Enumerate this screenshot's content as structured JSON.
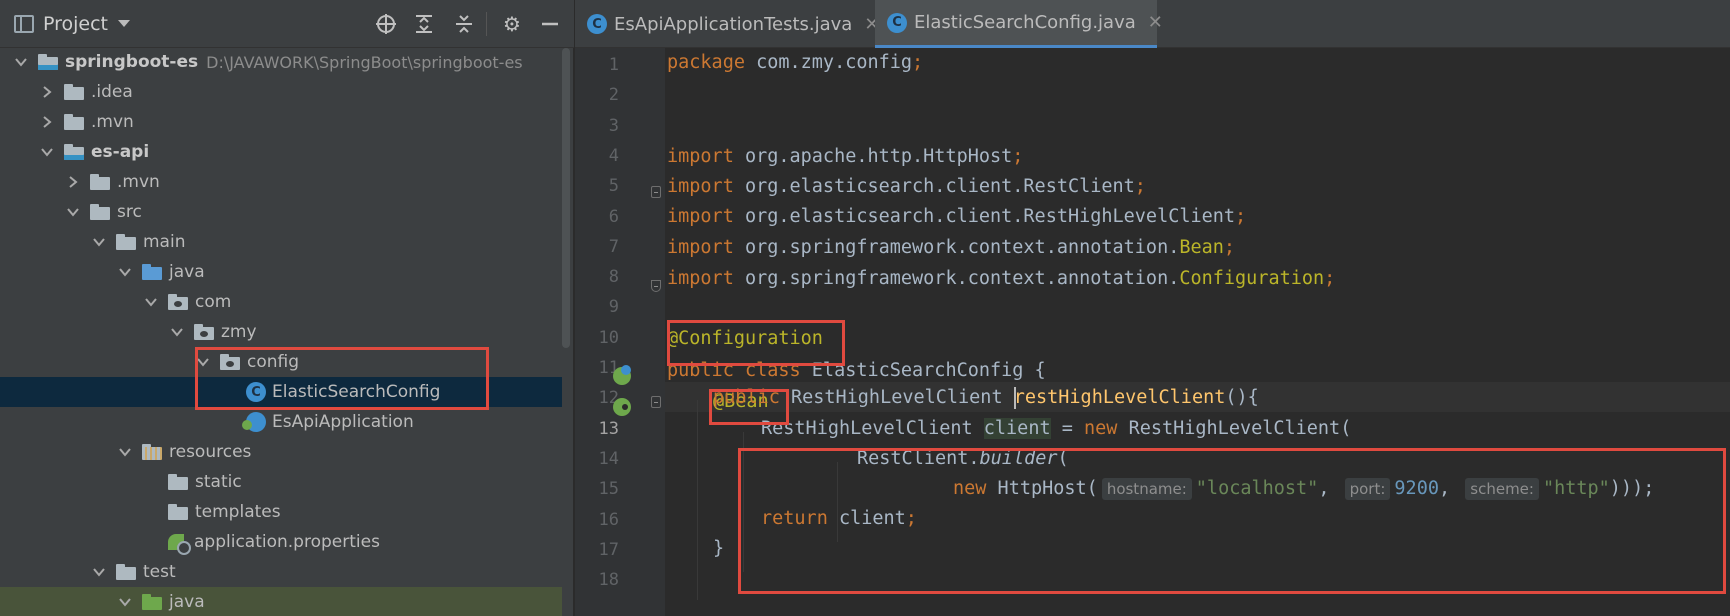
{
  "project_panel": {
    "title": "Project",
    "header_icons": [
      "locate-icon",
      "expand-all-icon",
      "collapse-all-icon",
      "gear-icon",
      "hide-icon"
    ],
    "tree": [
      {
        "label": "springboot-es",
        "path": "D:\\JAVAWORK\\SpringBoot\\springboot-es",
        "bold": true,
        "icon": "module-folder-icon",
        "expanded": true
      },
      {
        "label": ".idea",
        "icon": "folder-icon",
        "expanded": false
      },
      {
        "label": ".mvn",
        "icon": "folder-icon",
        "expanded": false
      },
      {
        "label": "es-api",
        "bold": true,
        "icon": "module-folder-icon",
        "expanded": true
      },
      {
        "label": ".mvn",
        "icon": "folder-icon",
        "expanded": false
      },
      {
        "label": "src",
        "icon": "folder-icon",
        "expanded": true
      },
      {
        "label": "main",
        "icon": "folder-icon",
        "expanded": true
      },
      {
        "label": "java",
        "icon": "source-folder-icon",
        "expanded": true
      },
      {
        "label": "com",
        "icon": "package-icon",
        "expanded": true
      },
      {
        "label": "zmy",
        "icon": "package-icon",
        "expanded": true
      },
      {
        "label": "config",
        "icon": "package-icon",
        "expanded": true
      },
      {
        "label": "ElasticSearchConfig",
        "icon": "class-icon",
        "selected": true
      },
      {
        "label": "EsApiApplication",
        "icon": "spring-boot-class-icon"
      },
      {
        "label": "resources",
        "icon": "resources-folder-icon",
        "expanded": true
      },
      {
        "label": "static",
        "icon": "folder-icon"
      },
      {
        "label": "templates",
        "icon": "folder-icon"
      },
      {
        "label": "application.properties",
        "icon": "spring-properties-icon"
      },
      {
        "label": "test",
        "icon": "folder-icon",
        "expanded": true
      },
      {
        "label": "java",
        "icon": "test-source-folder-icon",
        "expanded": true
      }
    ]
  },
  "tabs": [
    {
      "label": "EsApiApplicationTests.java",
      "active": false,
      "icon": "test-class-icon"
    },
    {
      "label": "ElasticSearchConfig.java",
      "active": true,
      "icon": "class-icon"
    }
  ],
  "editor": {
    "line_numbers": [
      "1",
      "2",
      "3",
      "4",
      "5",
      "6",
      "7",
      "8",
      "9",
      "10",
      "11",
      "12",
      "13",
      "14",
      "15",
      "16",
      "17",
      "18"
    ],
    "current_line": "13",
    "code": {
      "l1_kw": "package",
      "l1_rest": " com.zmy.config",
      "l1_semi": ";",
      "l4_kw": "import",
      "l4_rest": " org.apache.http.HttpHost",
      "l4_semi": ";",
      "l5_kw": "import",
      "l5_rest": " org.elasticsearch.client.RestClient",
      "l5_semi": ";",
      "l6_kw": "import",
      "l6_rest": " org.elasticsearch.client.RestHighLevelClient",
      "l6_semi": ";",
      "l7_kw": "import",
      "l7_rest": " org.springframework.context.annotation.",
      "l7_ann": "Bean",
      "l7_semi": ";",
      "l8_kw": "import",
      "l8_rest": " org.springframework.context.annotation.",
      "l8_ann": "Configuration",
      "l8_semi": ";",
      "l10_ann": "@Configuration",
      "l11_kw": "public class",
      "l11_rest": " ElasticSearchConfig {",
      "l12_ann": "@Bean",
      "l13_kw": "public",
      "l13_type": " RestHighLevelClient ",
      "l13_fn": "restHighLevelClient",
      "l13_rest": "(){",
      "l14_type": "RestHighLevelClient ",
      "l14_var": "client",
      "l14_eq": " = ",
      "l14_kw": "new",
      "l14_rest": " RestHighLevelClient(",
      "l15_cls": "RestClient.",
      "l15_fn": "builder",
      "l15_rest": "(",
      "l16_kw": "new",
      "l16_cls": " HttpHost(",
      "l16_hint1": "hostname:",
      "l16_str1": "\"localhost\"",
      "l16_c1": ", ",
      "l16_hint2": "port:",
      "l16_num": "9200",
      "l16_c2": ", ",
      "l16_hint3": "scheme:",
      "l16_str2": "\"http\"",
      "l16_end": ")));",
      "l17_kw": "return",
      "l17_rest": " client",
      "l17_semi": ";",
      "l18": "}"
    }
  },
  "colors": {
    "keyword": "#cc7832",
    "annotation": "#bbb529",
    "method": "#ffc66d",
    "string": "#6a8759",
    "number": "#6897bb",
    "highlight_box": "#e04a3f",
    "selection": "#0d293e"
  }
}
